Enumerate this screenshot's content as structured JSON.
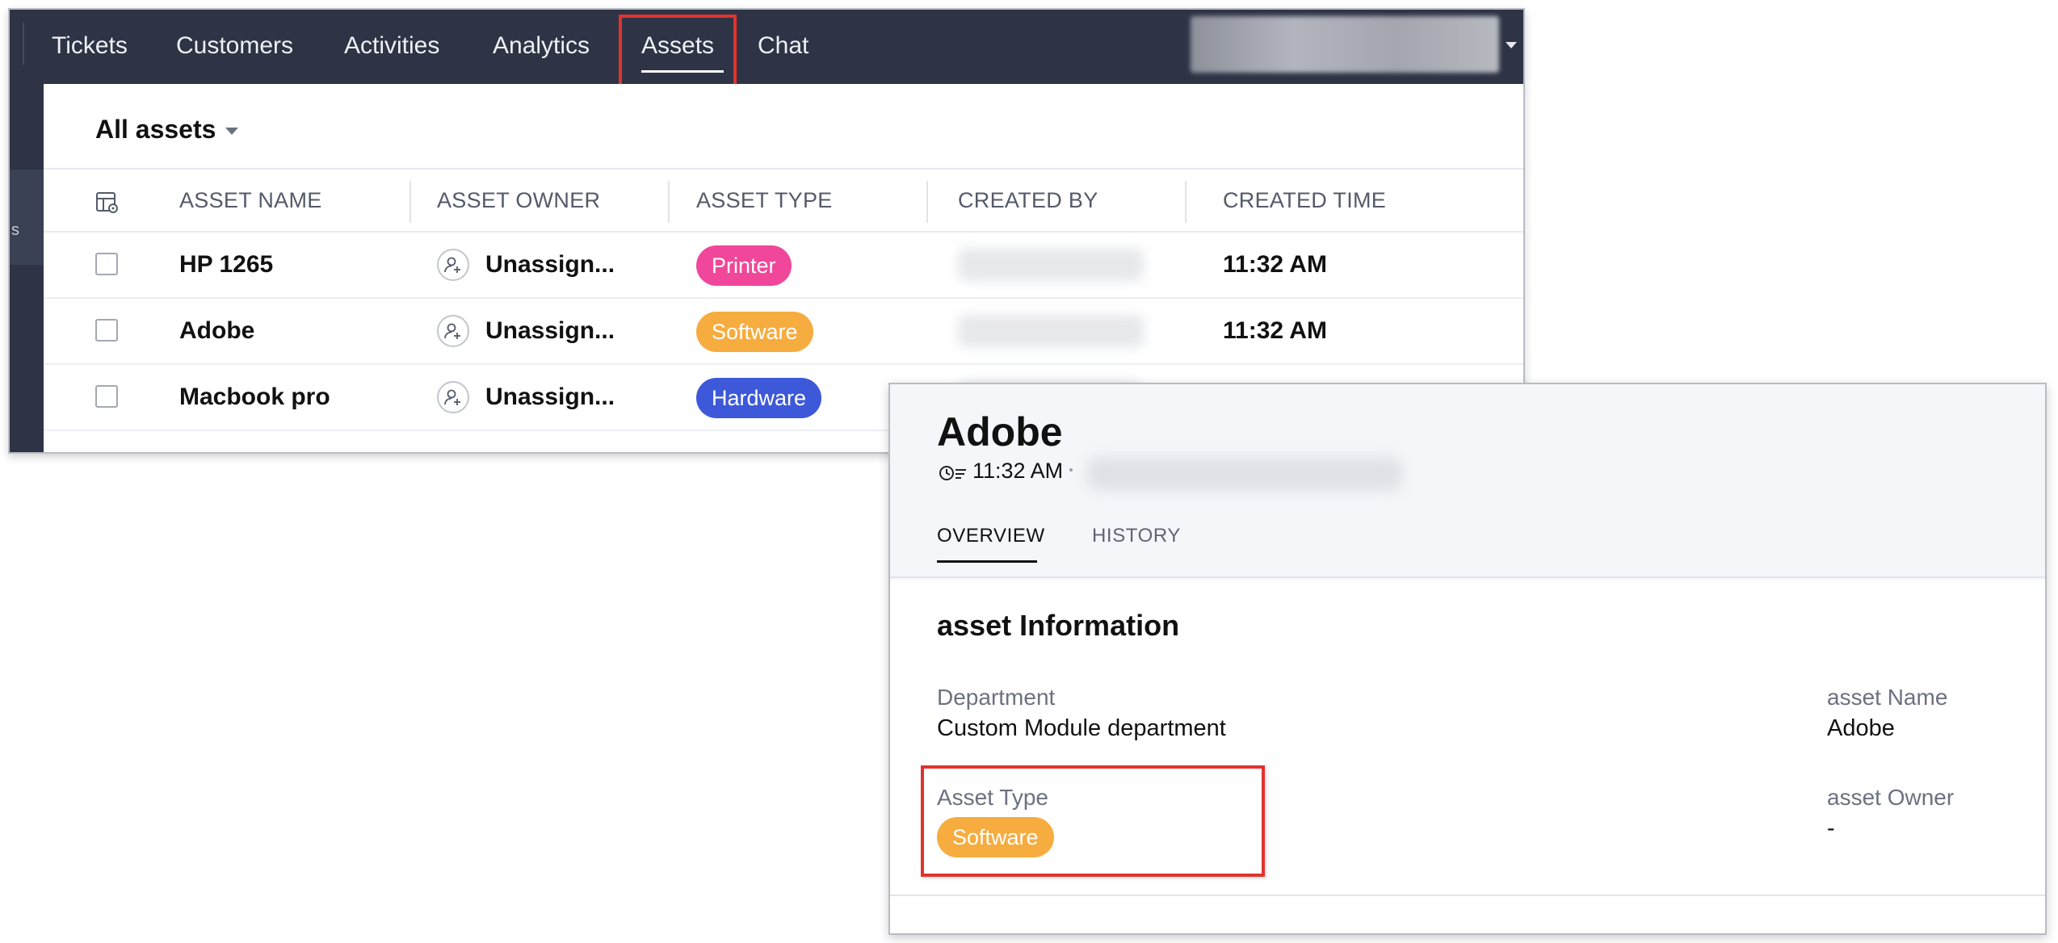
{
  "nav": {
    "tabs": [
      {
        "label": "Tickets"
      },
      {
        "label": "Customers"
      },
      {
        "label": "Activities"
      },
      {
        "label": "Analytics"
      },
      {
        "label": "Assets"
      },
      {
        "label": "Chat"
      }
    ],
    "active_tab": "Assets",
    "left_rail_glyph": "s"
  },
  "list": {
    "view_label": "All assets",
    "columns": [
      "ASSET NAME",
      "ASSET OWNER",
      "ASSET TYPE",
      "CREATED BY",
      "CREATED TIME"
    ],
    "rows": [
      {
        "name": "HP 1265",
        "owner": "Unassign...",
        "type": "Printer",
        "type_color": "#f0479a",
        "time": "11:32 AM"
      },
      {
        "name": "Adobe",
        "owner": "Unassign...",
        "type": "Software",
        "type_color": "#f6ac3f",
        "time": "11:32 AM"
      },
      {
        "name": "Macbook pro",
        "owner": "Unassign...",
        "type": "Hardware",
        "type_color": "#3d59d9",
        "time": ""
      }
    ]
  },
  "detail": {
    "title": "Adobe",
    "time": "11:32 AM",
    "tabs": [
      {
        "label": "OVERVIEW",
        "active": true
      },
      {
        "label": "HISTORY",
        "active": false
      }
    ],
    "section_title": "asset Information",
    "fields": {
      "department_label": "Department",
      "department_value": "Custom Module department",
      "asset_type_label": "Asset Type",
      "asset_type_value": "Software",
      "asset_name_label": "asset Name",
      "asset_name_value": "Adobe",
      "asset_owner_label": "asset Owner",
      "asset_owner_value": "-"
    }
  },
  "colors": {
    "nav_bg": "#2e3446",
    "highlight": "#e0332e",
    "printer": "#f0479a",
    "software": "#f6ac3f",
    "hardware": "#3d59d9"
  }
}
